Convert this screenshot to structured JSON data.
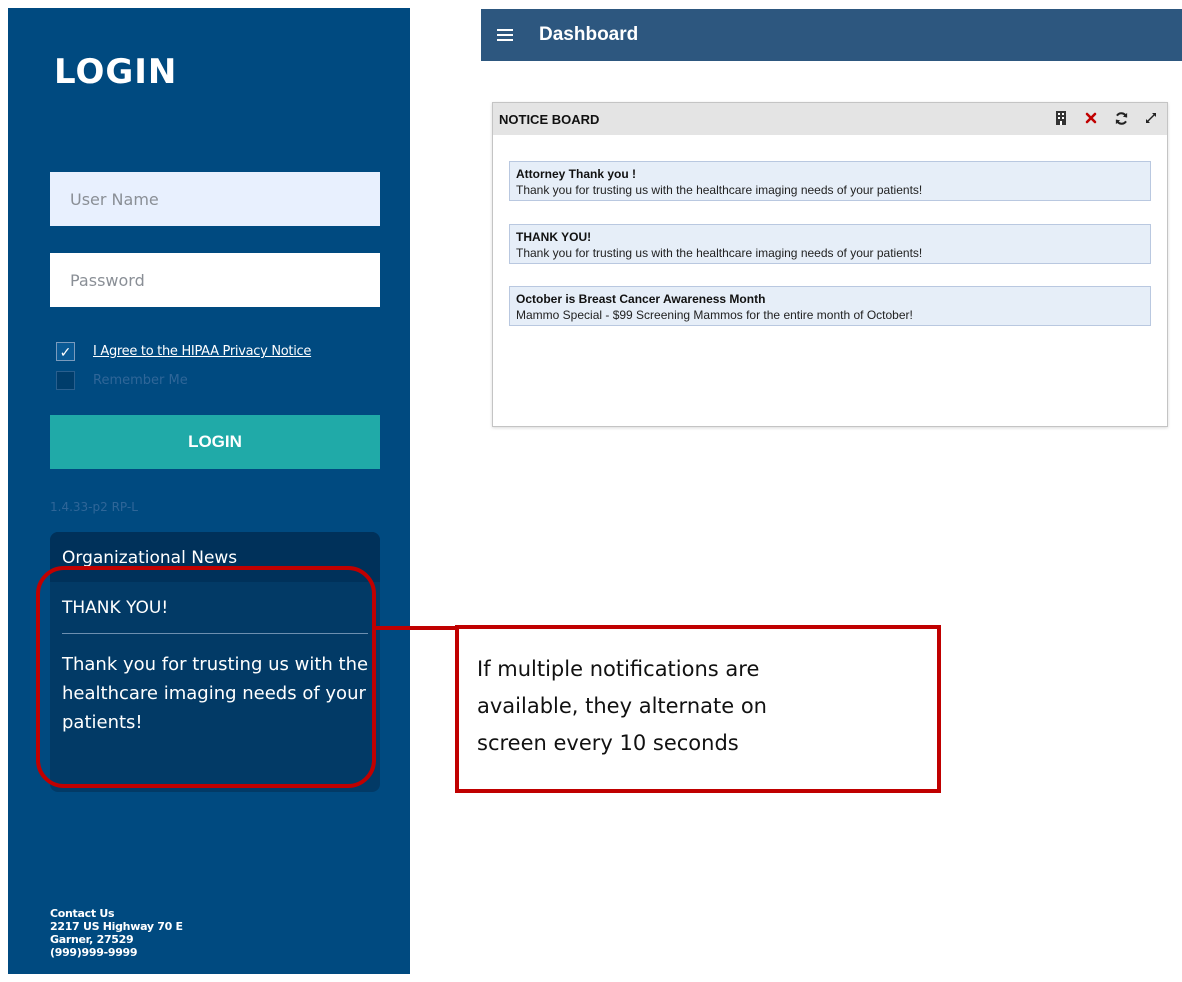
{
  "login": {
    "title": "LOGIN",
    "username_placeholder": "User Name",
    "password_placeholder": "Password",
    "hipaa_label": "I Agree to the HIPAA Privacy Notice",
    "hipaa_checked": true,
    "hipaa_check_glyph": "✓",
    "remember_label": "Remember Me",
    "remember_checked": false,
    "login_button": "LOGIN",
    "version": "1.4.33-p2 RP-L"
  },
  "news": {
    "header": "Organizational News",
    "title": "THANK YOU!",
    "body": "Thank you for trusting us with the healthcare imaging needs of your patients!"
  },
  "contact": {
    "title": "Contact Us",
    "address1": "2217 US Highway 70 E",
    "address2": "Garner, 27529",
    "phone": "(999)999-9999"
  },
  "dashboard": {
    "title": "Dashboard"
  },
  "notice_board": {
    "title": "NOTICE BOARD",
    "icons": [
      "building-icon",
      "close-icon",
      "refresh-icon",
      "expand-icon"
    ],
    "items": [
      {
        "title": "Attorney Thank you !",
        "body": "Thank you for trusting us with the healthcare imaging needs of your patients!"
      },
      {
        "title": "THANK YOU!",
        "body": "Thank you for trusting us with the healthcare imaging needs of your patients!"
      },
      {
        "title": "October is Breast Cancer Awareness Month",
        "body": "Mammo Special - $99 Screening Mammos for the entire month of October!"
      }
    ]
  },
  "callout": {
    "line1": "If multiple notifications are",
    "line2": "available, they alternate on",
    "line3": "screen every 10 seconds"
  },
  "colors": {
    "panel": "#004a80",
    "login_button": "#20aaa8",
    "dashboard_bar": "#2d577f",
    "highlight": "#c00000",
    "close_icon": "#c00000"
  }
}
